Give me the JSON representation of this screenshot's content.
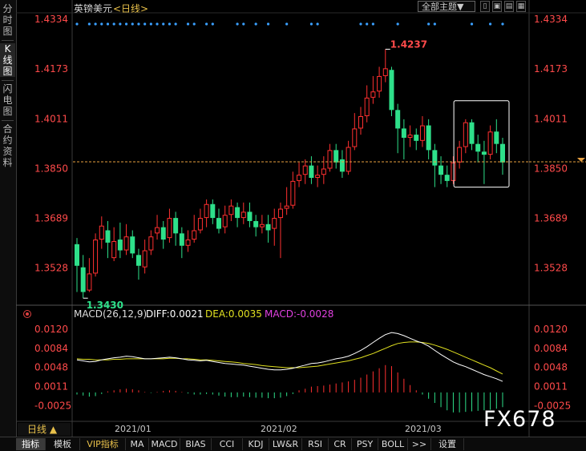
{
  "sidebar": {
    "tabs": [
      {
        "label": "分时图",
        "active": false
      },
      {
        "label": "K线图",
        "active": true
      },
      {
        "label": "闪电图",
        "active": false
      },
      {
        "label": "合约资料",
        "active": false
      }
    ]
  },
  "header": {
    "instrument": "英镑美元",
    "period_tag": "<日线>",
    "theme_button": "全部主题▼"
  },
  "chart_data": [
    {
      "type": "candlestick",
      "instrument": "英镑美元",
      "period": "日线",
      "y_ticks": [
        "1.4334",
        "1.4173",
        "1.4011",
        "1.3850",
        "1.3689",
        "1.3528"
      ],
      "ylim": [
        1.3415,
        1.4355
      ],
      "x_labels": [
        "2021/01",
        "2021/02",
        "2021/03"
      ],
      "annotations": {
        "high_label": "1.4237",
        "low_label": "1.3430"
      },
      "current_price_line": 1.3872,
      "colors": {
        "up": "#ff3030",
        "down": "#2ee08a",
        "dot": "#3aa0ff"
      },
      "candles": [
        [
          1.3605,
          1.3535,
          1.3625,
          1.345
        ],
        [
          1.353,
          1.345,
          1.357,
          1.343
        ],
        [
          1.3455,
          1.351,
          1.356,
          1.345
        ],
        [
          1.351,
          1.362,
          1.364,
          1.35
        ],
        [
          1.362,
          1.3665,
          1.3695,
          1.359
        ],
        [
          1.365,
          1.361,
          1.368,
          1.356
        ],
        [
          1.356,
          1.3615,
          1.366,
          1.355
        ],
        [
          1.362,
          1.3585,
          1.3675,
          1.356
        ],
        [
          1.3585,
          1.363,
          1.367,
          1.357
        ],
        [
          1.363,
          1.3575,
          1.365,
          1.356
        ],
        [
          1.357,
          1.3535,
          1.359,
          1.349
        ],
        [
          1.353,
          1.3585,
          1.362,
          1.351
        ],
        [
          1.3585,
          1.363,
          1.365,
          1.357
        ],
        [
          1.364,
          1.366,
          1.37,
          1.362
        ],
        [
          1.366,
          1.362,
          1.368,
          1.359
        ],
        [
          1.3625,
          1.369,
          1.372,
          1.361
        ],
        [
          1.369,
          1.364,
          1.371,
          1.36
        ],
        [
          1.364,
          1.36,
          1.366,
          1.356
        ],
        [
          1.36,
          1.362,
          1.365,
          1.358
        ],
        [
          1.362,
          1.365,
          1.37,
          1.361
        ],
        [
          1.365,
          1.369,
          1.372,
          1.364
        ],
        [
          1.369,
          1.3735,
          1.375,
          1.366
        ],
        [
          1.3735,
          1.369,
          1.375,
          1.367
        ],
        [
          1.369,
          1.3655,
          1.372,
          1.364
        ],
        [
          1.366,
          1.37,
          1.373,
          1.364
        ],
        [
          1.37,
          1.373,
          1.375,
          1.368
        ],
        [
          1.3725,
          1.369,
          1.374,
          1.366
        ],
        [
          1.369,
          1.371,
          1.374,
          1.367
        ],
        [
          1.371,
          1.368,
          1.374,
          1.366
        ],
        [
          1.368,
          1.366,
          1.37,
          1.363
        ],
        [
          1.366,
          1.367,
          1.37,
          1.364
        ],
        [
          1.367,
          1.365,
          1.37,
          1.361
        ],
        [
          1.3655,
          1.369,
          1.372,
          1.36
        ],
        [
          1.369,
          1.372,
          1.374,
          1.356
        ],
        [
          1.372,
          1.373,
          1.379,
          1.37
        ],
        [
          1.373,
          1.381,
          1.384,
          1.372
        ],
        [
          1.381,
          1.383,
          1.387,
          1.379
        ],
        [
          1.383,
          1.386,
          1.388,
          1.38
        ],
        [
          1.386,
          1.382,
          1.389,
          1.38
        ],
        [
          1.382,
          1.383,
          1.386,
          1.379
        ],
        [
          1.383,
          1.385,
          1.389,
          1.38
        ],
        [
          1.385,
          1.391,
          1.393,
          1.384
        ],
        [
          1.391,
          1.387,
          1.393,
          1.385
        ],
        [
          1.388,
          1.384,
          1.391,
          1.382
        ],
        [
          1.384,
          1.392,
          1.394,
          1.383
        ],
        [
          1.392,
          1.398,
          1.403,
          1.391
        ],
        [
          1.398,
          1.402,
          1.405,
          1.396
        ],
        [
          1.402,
          1.408,
          1.412,
          1.4
        ],
        [
          1.408,
          1.41,
          1.415,
          1.406
        ],
        [
          1.41,
          1.415,
          1.418,
          1.408
        ],
        [
          1.415,
          1.4175,
          1.4237,
          1.413
        ],
        [
          1.417,
          1.404,
          1.418,
          1.402
        ],
        [
          1.404,
          1.398,
          1.406,
          1.39
        ],
        [
          1.398,
          1.395,
          1.401,
          1.388
        ],
        [
          1.395,
          1.396,
          1.399,
          1.392
        ],
        [
          1.396,
          1.394,
          1.398,
          1.391
        ],
        [
          1.394,
          1.399,
          1.402,
          1.392
        ],
        [
          1.399,
          1.391,
          1.401,
          1.388
        ],
        [
          1.391,
          1.386,
          1.393,
          1.379
        ],
        [
          1.386,
          1.383,
          1.389,
          1.38
        ],
        [
          1.383,
          1.381,
          1.386,
          1.379
        ],
        [
          1.381,
          1.387,
          1.389,
          1.38
        ],
        [
          1.387,
          1.392,
          1.394,
          1.385
        ],
        [
          1.392,
          1.4,
          1.401,
          1.39
        ],
        [
          1.4,
          1.393,
          1.401,
          1.391
        ],
        [
          1.393,
          1.3905,
          1.396,
          1.387
        ],
        [
          1.3905,
          1.3895,
          1.394,
          1.38
        ],
        [
          1.3895,
          1.397,
          1.399,
          1.388
        ],
        [
          1.397,
          1.393,
          1.401,
          1.39
        ],
        [
          1.393,
          1.387,
          1.395,
          1.383
        ]
      ],
      "top_dots_at": [
        0,
        2,
        3,
        4,
        5,
        6,
        7,
        8,
        9,
        10,
        11,
        12,
        13,
        14,
        15,
        16,
        18,
        19,
        21,
        22,
        26,
        27,
        29,
        31,
        34,
        38,
        39,
        46,
        47,
        48,
        52,
        57,
        58,
        64,
        67,
        69
      ]
    },
    {
      "type": "line+bar",
      "indicator": "MACD",
      "params": "MACD(26,12,9)",
      "legend": {
        "diff_text": "DIFF:0.0021",
        "dea_text": "DEA:0.0035",
        "macd_text": "MACD:-0.0028"
      },
      "y_ticks": [
        "0.0120",
        "0.0084",
        "0.0048",
        "0.0011",
        "-0.0025"
      ],
      "ylim": [
        -0.0052,
        0.014
      ],
      "colors": {
        "diff": "#ffffff",
        "dea": "#e0e020",
        "hist_up": "#ff3030",
        "hist_down": "#2ee08a"
      },
      "diff": [
        0.0062,
        0.006,
        0.0058,
        0.0059,
        0.0062,
        0.0064,
        0.0066,
        0.0067,
        0.0069,
        0.0068,
        0.0066,
        0.0064,
        0.0064,
        0.0065,
        0.0066,
        0.0067,
        0.0066,
        0.0064,
        0.0062,
        0.0061,
        0.006,
        0.0061,
        0.0059,
        0.0057,
        0.0055,
        0.0054,
        0.0053,
        0.0052,
        0.005,
        0.0048,
        0.0046,
        0.0044,
        0.0043,
        0.0043,
        0.0044,
        0.0046,
        0.0049,
        0.0052,
        0.0055,
        0.0056,
        0.0058,
        0.0061,
        0.0064,
        0.0066,
        0.0069,
        0.0074,
        0.008,
        0.0087,
        0.0095,
        0.0103,
        0.011,
        0.0114,
        0.0112,
        0.0108,
        0.0103,
        0.0098,
        0.0094,
        0.0088,
        0.008,
        0.0072,
        0.0065,
        0.0058,
        0.0053,
        0.0049,
        0.0044,
        0.0039,
        0.0034,
        0.003,
        0.0026,
        0.0021
      ],
      "dea": [
        0.0064,
        0.0063,
        0.0063,
        0.0062,
        0.0062,
        0.0062,
        0.0063,
        0.0063,
        0.0064,
        0.0064,
        0.0064,
        0.0064,
        0.0064,
        0.0064,
        0.0064,
        0.0065,
        0.0065,
        0.0064,
        0.0064,
        0.0063,
        0.0062,
        0.0062,
        0.0061,
        0.006,
        0.0059,
        0.0058,
        0.0057,
        0.0055,
        0.0054,
        0.0053,
        0.0051,
        0.005,
        0.0049,
        0.0048,
        0.0047,
        0.0047,
        0.0047,
        0.0048,
        0.0049,
        0.005,
        0.0052,
        0.0054,
        0.0056,
        0.0058,
        0.006,
        0.0063,
        0.0066,
        0.007,
        0.0074,
        0.0079,
        0.0084,
        0.0089,
        0.0093,
        0.0095,
        0.0096,
        0.0096,
        0.0095,
        0.0093,
        0.009,
        0.0086,
        0.0082,
        0.0077,
        0.0072,
        0.0067,
        0.0062,
        0.0057,
        0.0052,
        0.0047,
        0.0041,
        0.0035
      ],
      "hist": [
        -0.0004,
        -0.0006,
        -0.0008,
        -0.0007,
        -0.0003,
        0.0002,
        0.0004,
        0.0006,
        0.0007,
        0.0006,
        0.0004,
        0.0001,
        -0.0001,
        0.0001,
        0.0003,
        0.0004,
        0.0003,
        0.0001,
        -0.0002,
        -0.0004,
        -0.0004,
        -0.0003,
        -0.0004,
        -0.0006,
        -0.0008,
        -0.0009,
        -0.0009,
        -0.0008,
        -0.0009,
        -0.001,
        -0.001,
        -0.0011,
        -0.0011,
        -0.001,
        -0.0007,
        -0.0003,
        0.0004,
        0.0007,
        0.0011,
        0.0012,
        0.0013,
        0.0015,
        0.0017,
        0.0019,
        0.0021,
        0.0024,
        0.0028,
        0.0034,
        0.004,
        0.0046,
        0.0052,
        0.005,
        0.0038,
        0.0026,
        0.0014,
        0.0004,
        -0.0004,
        -0.0012,
        -0.002,
        -0.0028,
        -0.0034,
        -0.0038,
        -0.0038,
        -0.0037,
        -0.0036,
        -0.0035,
        -0.0034,
        -0.0033,
        -0.0031,
        -0.0028
      ]
    }
  ],
  "bottom_period": "日线",
  "bottom_tabs": [
    {
      "label": "指标",
      "selected": true
    },
    {
      "label": "模板"
    },
    {
      "label": "VIP指标",
      "vip": true
    },
    {
      "label": "MA"
    },
    {
      "label": "MACD"
    },
    {
      "label": "BIAS"
    },
    {
      "label": "CCI"
    },
    {
      "label": "KDJ"
    },
    {
      "label": "LW&R"
    },
    {
      "label": "RSI"
    },
    {
      "label": "CR"
    },
    {
      "label": "PSY"
    },
    {
      "label": "BOLL"
    },
    {
      "label": ">>"
    },
    {
      "label": "设置"
    }
  ],
  "watermark": "FX678"
}
